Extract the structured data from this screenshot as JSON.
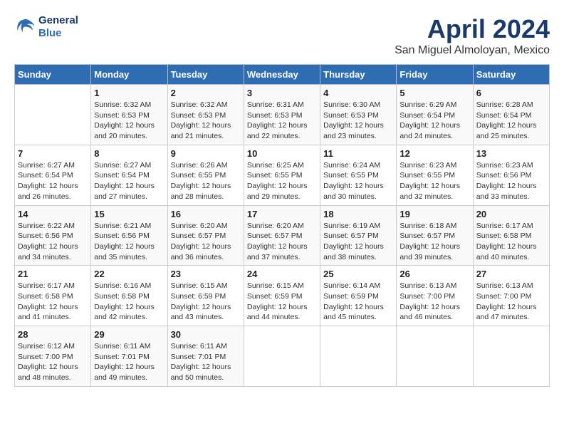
{
  "header": {
    "logo_line1": "General",
    "logo_line2": "Blue",
    "month_year": "April 2024",
    "location": "San Miguel Almoloyan, Mexico"
  },
  "weekdays": [
    "Sunday",
    "Monday",
    "Tuesday",
    "Wednesday",
    "Thursday",
    "Friday",
    "Saturday"
  ],
  "weeks": [
    [
      {
        "day": "",
        "info": ""
      },
      {
        "day": "1",
        "info": "Sunrise: 6:32 AM\nSunset: 6:53 PM\nDaylight: 12 hours\nand 20 minutes."
      },
      {
        "day": "2",
        "info": "Sunrise: 6:32 AM\nSunset: 6:53 PM\nDaylight: 12 hours\nand 21 minutes."
      },
      {
        "day": "3",
        "info": "Sunrise: 6:31 AM\nSunset: 6:53 PM\nDaylight: 12 hours\nand 22 minutes."
      },
      {
        "day": "4",
        "info": "Sunrise: 6:30 AM\nSunset: 6:53 PM\nDaylight: 12 hours\nand 23 minutes."
      },
      {
        "day": "5",
        "info": "Sunrise: 6:29 AM\nSunset: 6:54 PM\nDaylight: 12 hours\nand 24 minutes."
      },
      {
        "day": "6",
        "info": "Sunrise: 6:28 AM\nSunset: 6:54 PM\nDaylight: 12 hours\nand 25 minutes."
      }
    ],
    [
      {
        "day": "7",
        "info": "Sunrise: 6:27 AM\nSunset: 6:54 PM\nDaylight: 12 hours\nand 26 minutes."
      },
      {
        "day": "8",
        "info": "Sunrise: 6:27 AM\nSunset: 6:54 PM\nDaylight: 12 hours\nand 27 minutes."
      },
      {
        "day": "9",
        "info": "Sunrise: 6:26 AM\nSunset: 6:55 PM\nDaylight: 12 hours\nand 28 minutes."
      },
      {
        "day": "10",
        "info": "Sunrise: 6:25 AM\nSunset: 6:55 PM\nDaylight: 12 hours\nand 29 minutes."
      },
      {
        "day": "11",
        "info": "Sunrise: 6:24 AM\nSunset: 6:55 PM\nDaylight: 12 hours\nand 30 minutes."
      },
      {
        "day": "12",
        "info": "Sunrise: 6:23 AM\nSunset: 6:55 PM\nDaylight: 12 hours\nand 32 minutes."
      },
      {
        "day": "13",
        "info": "Sunrise: 6:23 AM\nSunset: 6:56 PM\nDaylight: 12 hours\nand 33 minutes."
      }
    ],
    [
      {
        "day": "14",
        "info": "Sunrise: 6:22 AM\nSunset: 6:56 PM\nDaylight: 12 hours\nand 34 minutes."
      },
      {
        "day": "15",
        "info": "Sunrise: 6:21 AM\nSunset: 6:56 PM\nDaylight: 12 hours\nand 35 minutes."
      },
      {
        "day": "16",
        "info": "Sunrise: 6:20 AM\nSunset: 6:57 PM\nDaylight: 12 hours\nand 36 minutes."
      },
      {
        "day": "17",
        "info": "Sunrise: 6:20 AM\nSunset: 6:57 PM\nDaylight: 12 hours\nand 37 minutes."
      },
      {
        "day": "18",
        "info": "Sunrise: 6:19 AM\nSunset: 6:57 PM\nDaylight: 12 hours\nand 38 minutes."
      },
      {
        "day": "19",
        "info": "Sunrise: 6:18 AM\nSunset: 6:57 PM\nDaylight: 12 hours\nand 39 minutes."
      },
      {
        "day": "20",
        "info": "Sunrise: 6:17 AM\nSunset: 6:58 PM\nDaylight: 12 hours\nand 40 minutes."
      }
    ],
    [
      {
        "day": "21",
        "info": "Sunrise: 6:17 AM\nSunset: 6:58 PM\nDaylight: 12 hours\nand 41 minutes."
      },
      {
        "day": "22",
        "info": "Sunrise: 6:16 AM\nSunset: 6:58 PM\nDaylight: 12 hours\nand 42 minutes."
      },
      {
        "day": "23",
        "info": "Sunrise: 6:15 AM\nSunset: 6:59 PM\nDaylight: 12 hours\nand 43 minutes."
      },
      {
        "day": "24",
        "info": "Sunrise: 6:15 AM\nSunset: 6:59 PM\nDaylight: 12 hours\nand 44 minutes."
      },
      {
        "day": "25",
        "info": "Sunrise: 6:14 AM\nSunset: 6:59 PM\nDaylight: 12 hours\nand 45 minutes."
      },
      {
        "day": "26",
        "info": "Sunrise: 6:13 AM\nSunset: 7:00 PM\nDaylight: 12 hours\nand 46 minutes."
      },
      {
        "day": "27",
        "info": "Sunrise: 6:13 AM\nSunset: 7:00 PM\nDaylight: 12 hours\nand 47 minutes."
      }
    ],
    [
      {
        "day": "28",
        "info": "Sunrise: 6:12 AM\nSunset: 7:00 PM\nDaylight: 12 hours\nand 48 minutes."
      },
      {
        "day": "29",
        "info": "Sunrise: 6:11 AM\nSunset: 7:01 PM\nDaylight: 12 hours\nand 49 minutes."
      },
      {
        "day": "30",
        "info": "Sunrise: 6:11 AM\nSunset: 7:01 PM\nDaylight: 12 hours\nand 50 minutes."
      },
      {
        "day": "",
        "info": ""
      },
      {
        "day": "",
        "info": ""
      },
      {
        "day": "",
        "info": ""
      },
      {
        "day": "",
        "info": ""
      }
    ]
  ]
}
